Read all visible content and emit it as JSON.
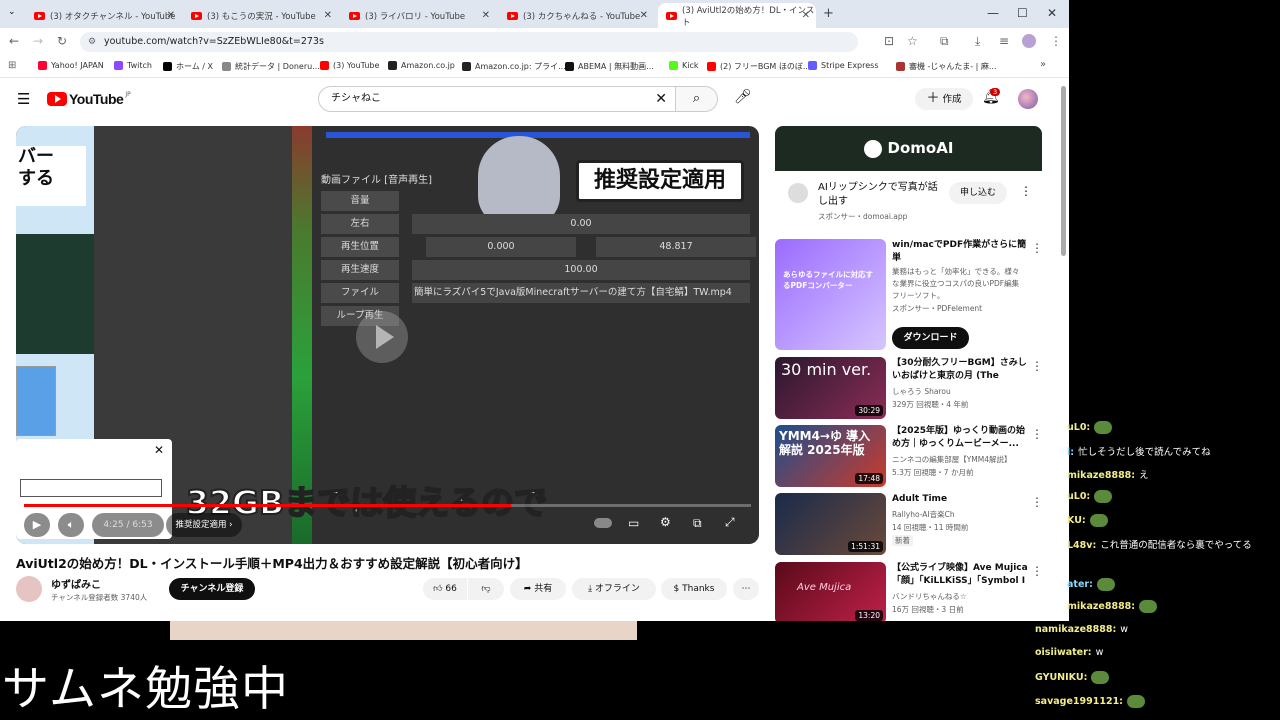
{
  "tabs": [
    {
      "label": "(3) オタクチャンネル - YouTube"
    },
    {
      "label": "(3) もこうの実況 - YouTube"
    },
    {
      "label": "(3) ライバロリ - YouTube"
    },
    {
      "label": "(3) カクちゃんねる - YouTube"
    },
    {
      "label": "(3) AviUtl2の始め方！DL・インスト"
    }
  ],
  "address": {
    "url": "youtube.com/watch?v=SzZEbWLIe80&t=273s"
  },
  "bookmarks": [
    {
      "label": "Yahoo! JAPAN",
      "color": "#ff0033"
    },
    {
      "label": "Twitch",
      "color": "#9146ff"
    },
    {
      "label": "ホーム / X",
      "color": "#000000"
    },
    {
      "label": "統計データ | Doneru...",
      "color": "#888888"
    },
    {
      "label": "(3) YouTube",
      "color": "#ff0000"
    },
    {
      "label": "Amazon.co.jp",
      "color": "#222222"
    },
    {
      "label": "Amazon.co.jp: プライ...",
      "color": "#222222"
    },
    {
      "label": "ABEMA | 無料動画...",
      "color": "#111111"
    },
    {
      "label": "Kick",
      "color": "#53fc18"
    },
    {
      "label": "(2) フリーBGM ほのぼ...",
      "color": "#ff0000"
    },
    {
      "label": "Stripe Express",
      "color": "#635bff"
    },
    {
      "label": "審機 -じゃんたま- | 麻...",
      "color": "#aa3333"
    }
  ],
  "youtube": {
    "logo": "YouTube",
    "region": "JP",
    "search_value": "チシャねこ",
    "create_label": "作成",
    "notif_count": "3"
  },
  "video": {
    "panel_title": "動画ファイル [音声再生]",
    "banner": "推奨設定適用",
    "rows": [
      {
        "label": "音量",
        "value": ""
      },
      {
        "label": "左右",
        "value": "0.00"
      },
      {
        "label": "再生位置",
        "value": "0.000",
        "value2": "48.817"
      },
      {
        "label": "再生速度",
        "value": "100.00"
      },
      {
        "label": "ファイル",
        "value": "簡単にラズパイ5でJava版Minecraftサーバーの建て方【自宅鯖】TW.mp4"
      },
      {
        "label": "ループ再生",
        "value": ""
      }
    ],
    "side_text_top": "バー",
    "side_text_bottom": "する",
    "subtitle": "32GBまでは使えるので",
    "time": "4:25 / 6:53",
    "chapter": "推奨設定適用",
    "progress": 0.67
  },
  "meta": {
    "title": "AviUtl2の始め方！DL・インストール手順＋MP4出力＆おすすめ設定解説【初心者向け】",
    "channel": "ゆずぱみこ",
    "subscribers": "チャンネル登録者数 3740人",
    "subscribe": "チャンネル登録",
    "likes": "66",
    "share": "共有",
    "offline": "オフライン",
    "thanks": "Thanks"
  },
  "ad": {
    "brand": "DomoAI",
    "title": "AIリップシンクで写真が話し出す",
    "sponsor": "スポンサー・domoai.app",
    "cta": "申し込む"
  },
  "recs": [
    {
      "title": "win/macでPDF作業がさらに簡単",
      "desc": "業務はもっと「効率化」できる。様々な業界に役立つコスパの良いPDF編集フリーソフト。",
      "channel": "スポンサー・PDFelement",
      "cta": "ダウンロード",
      "thumb_text": "あらゆるファイルに対応するPDFコンバーター",
      "duration": ""
    },
    {
      "title": "【30分耐久フリーBGM】さみしいおばけと東京の月 (The lonel...",
      "channel": "しゃろう Sharou",
      "stats": "329万 回視聴・4 年前",
      "thumb_text": "30 min ver.",
      "duration": "30:29"
    },
    {
      "title": "【2025年版】ゆっくり動画の始め方｜ゆっくりムービーメー...",
      "channel": "ニンネコの編集部屋【YMM4解説】",
      "stats": "5.3万 回視聴・7 か月前",
      "thumb_text": "YMM4→ゆ 導入解説 2025年版",
      "duration": "17:48"
    },
    {
      "title": "Adult Time",
      "channel": "Rallyho-AI音楽Ch",
      "stats": "14 回視聴・11 時間前",
      "badge": "新着",
      "duration": "1:51:31"
    },
    {
      "title": "【公式ライブ映像】Ave Mujica「顔」「KiLLKiSS」「Symbol I : △...",
      "channel": "バンドリちゃんねる☆",
      "stats": "16万 回視聴・3 日前",
      "thumb_text": "Ave Mujica",
      "duration": "13:20"
    }
  ],
  "overlay": {
    "caption": "サムネ勉強中"
  },
  "chat": [
    {
      "user": "uL0:",
      "msg": ""
    },
    {
      "user": "i:",
      "msg": "忙しそうだし後で読んでみてね"
    },
    {
      "user": "mikaze8888:",
      "msg": "え"
    },
    {
      "user": "uL0:",
      "msg": ""
    },
    {
      "user": "KU:",
      "msg": ""
    },
    {
      "user": "L48v:",
      "msg": "これ普通の配信者なら裏でやってる"
    },
    {
      "user": "ater:",
      "msg": ""
    },
    {
      "user": "mikaze8888:",
      "msg": ""
    },
    {
      "user": "namikaze8888:",
      "msg": "w"
    },
    {
      "user": "oisiiwater:",
      "msg": "w"
    },
    {
      "user": "GYUNIKU:",
      "msg": ""
    },
    {
      "user": "savage1991121:",
      "msg": ""
    }
  ]
}
